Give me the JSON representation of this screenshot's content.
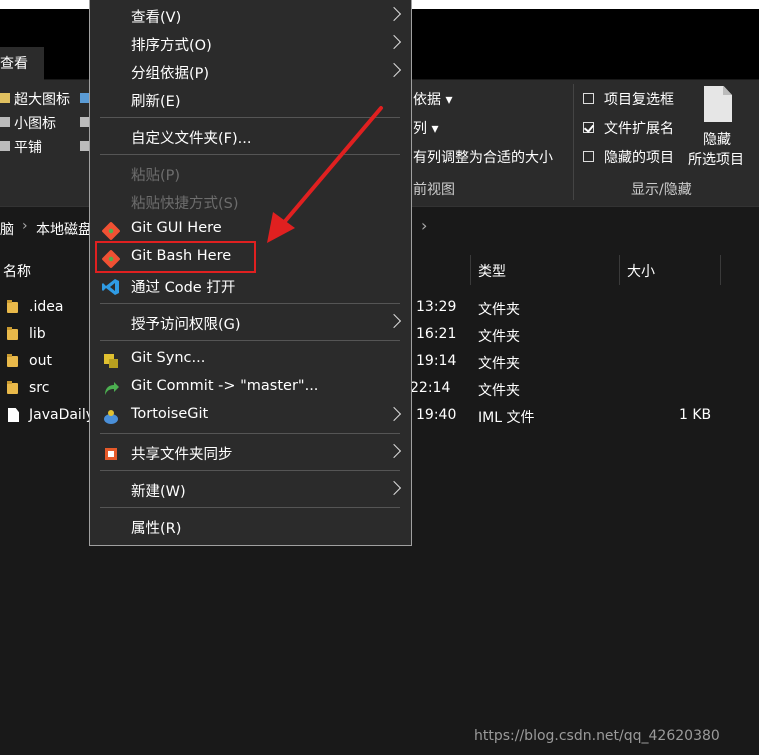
{
  "tabs": {
    "view": "查看"
  },
  "ribbon": {
    "layout_items": [
      "超大图标",
      "小图标",
      "平铺"
    ],
    "sort_items": [
      "依据",
      "列",
      "有列调整为合适的大小"
    ],
    "current_view_group": "前视图",
    "checkboxes": [
      {
        "label": "项目复选框",
        "checked": false
      },
      {
        "label": "文件扩展名",
        "checked": true
      },
      {
        "label": "隐藏的项目",
        "checked": false
      }
    ],
    "showhide_group": "显示/隐藏",
    "hide_selected_line1": "隐藏",
    "hide_selected_line2": "所选项目"
  },
  "address": {
    "crumb1": "脑",
    "crumb2": "本地磁盘"
  },
  "columns": {
    "name": "名称",
    "type": "类型",
    "size": "大小"
  },
  "files": [
    {
      "name": ".idea",
      "time": "13:29",
      "type": "文件夹",
      "size": "",
      "kind": "folder"
    },
    {
      "name": "lib",
      "time": "16:21",
      "type": "文件夹",
      "size": "",
      "kind": "folder"
    },
    {
      "name": "out",
      "time": "19:14",
      "type": "文件夹",
      "size": "",
      "kind": "folder"
    },
    {
      "name": "src",
      "time": "22:14",
      "type": "文件夹",
      "size": "",
      "kind": "folder"
    },
    {
      "name": "JavaDaily",
      "time": "19:40",
      "type": "IML 文件",
      "size": "1 KB",
      "kind": "file"
    }
  ],
  "context_menu": {
    "view": "查看(V)",
    "sort_by": "排序方式(O)",
    "group_by": "分组依据(P)",
    "refresh": "刷新(E)",
    "customize_folder": "自定义文件夹(F)...",
    "paste": "粘贴(P)",
    "paste_shortcut": "粘贴快捷方式(S)",
    "git_gui": "Git GUI Here",
    "git_bash": "Git Bash Here",
    "open_with_code": "通过 Code 打开",
    "give_access": "授予访问权限(G)",
    "git_sync": "Git Sync...",
    "git_commit": "Git Commit -> \"master\"...",
    "tortoisegit": "TortoiseGit",
    "share_sync": "共享文件夹同步",
    "new": "新建(W)",
    "properties": "属性(R)"
  },
  "watermark": "https://blog.csdn.net/qq_42620380",
  "colors": {
    "highlight": "#e02020",
    "folder": "#e9b94a",
    "vscode": "#2f9be4"
  }
}
